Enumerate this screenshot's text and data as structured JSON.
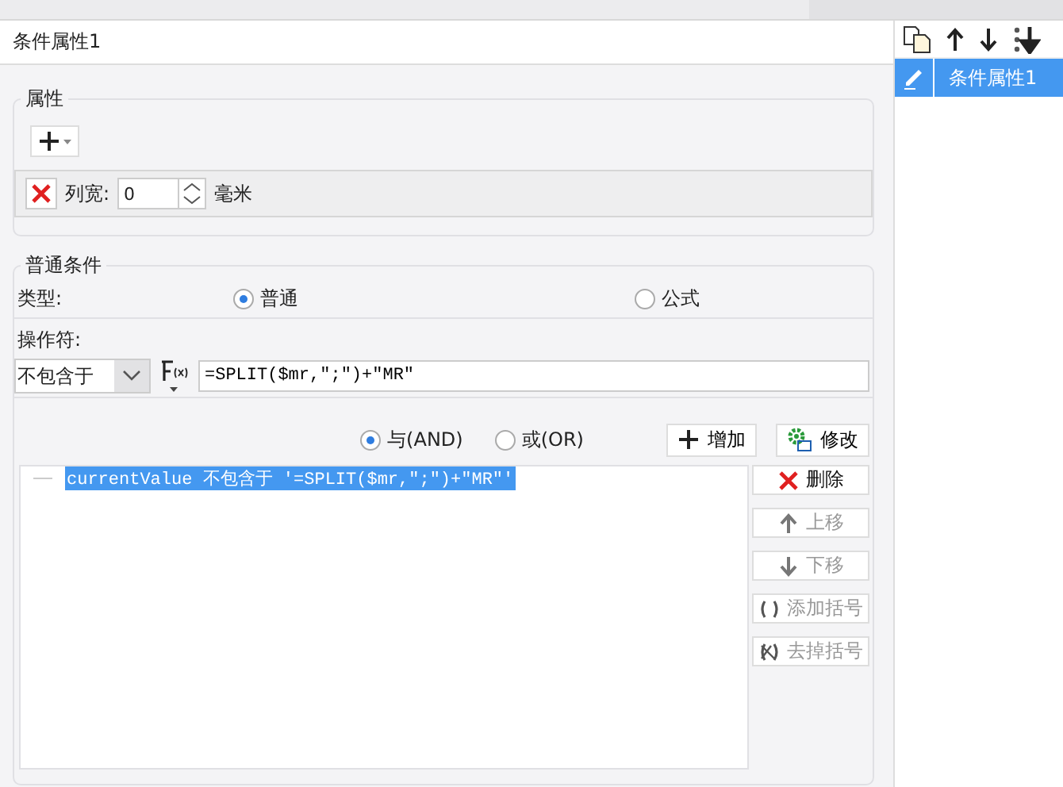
{
  "window": {
    "title": "条件属性1"
  },
  "properties": {
    "legend": "属性",
    "width_label": "列宽:",
    "width_value": "0",
    "unit": "毫米"
  },
  "condition": {
    "legend": "普通条件",
    "type_label": "类型:",
    "types": [
      {
        "label": "普通",
        "selected": true
      },
      {
        "label": "公式",
        "selected": false
      }
    ],
    "operator_label": "操作符:",
    "operator": "不包含于",
    "formula": "=SPLIT($mr,\";\")+\"MR\"",
    "joins": [
      {
        "label": "与(AND)",
        "selected": true
      },
      {
        "label": "或(OR)",
        "selected": false
      }
    ],
    "add_button": "增加",
    "edit_button": "修改",
    "conditions": [
      {
        "text": "currentValue 不包含于 '=SPLIT($mr,\";\")+\"MR\"'",
        "selected": true
      }
    ],
    "actions": [
      {
        "label": "删除",
        "kind": "delete",
        "disabled": false
      },
      {
        "label": "上移",
        "kind": "up",
        "disabled": true
      },
      {
        "label": "下移",
        "kind": "down",
        "disabled": true
      },
      {
        "label": "添加括号",
        "kind": "addparen",
        "disabled": true
      },
      {
        "label": "去掉括号",
        "kind": "removeparen",
        "disabled": true
      }
    ]
  },
  "sidebar": {
    "items": [
      {
        "label": "条件属性1",
        "selected": true
      }
    ]
  }
}
